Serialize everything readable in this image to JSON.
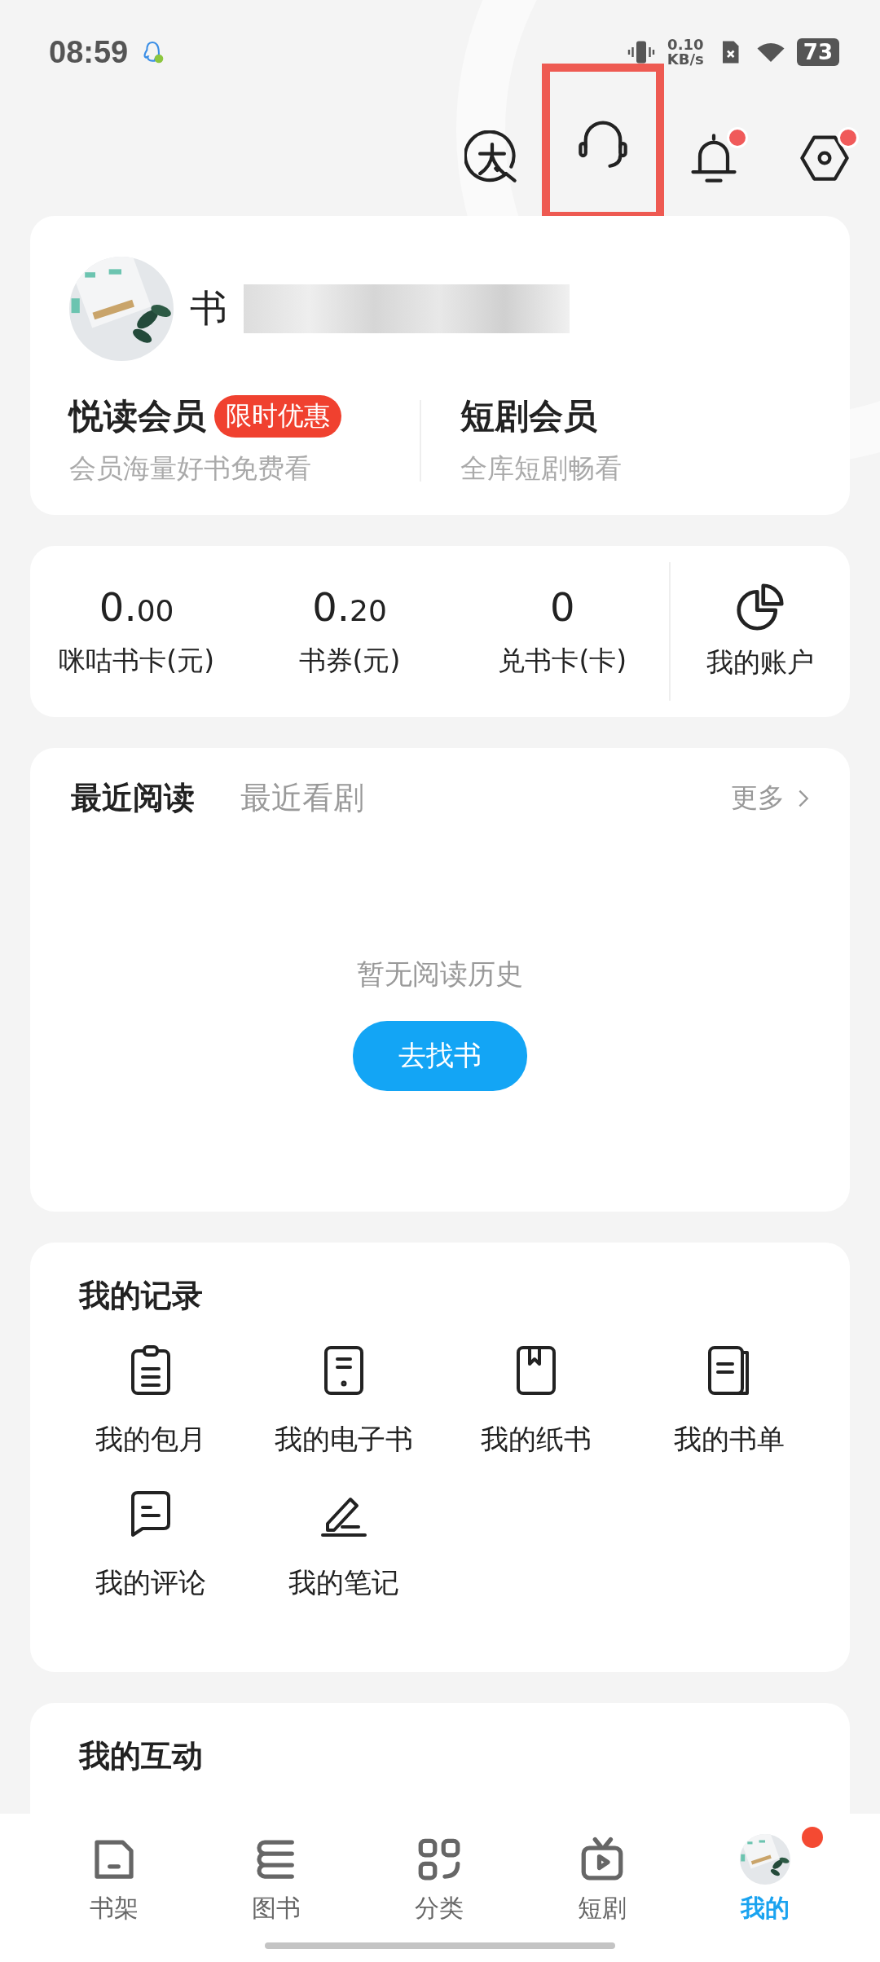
{
  "status_bar": {
    "time": "08:59",
    "speed_value": "0.10",
    "speed_unit": "KB/s",
    "battery": "73"
  },
  "top_actions": [
    {
      "kind": "font",
      "badge": false,
      "highlighted": false
    },
    {
      "kind": "headset",
      "badge": false,
      "highlighted": true
    },
    {
      "kind": "bell",
      "badge": true,
      "highlighted": false
    },
    {
      "kind": "settings",
      "badge": true,
      "highlighted": false
    }
  ],
  "profile": {
    "name": "书",
    "memberships": [
      {
        "title": "悦读会员",
        "tag": "限时优惠",
        "subtitle": "会员海量好书免费看"
      },
      {
        "title": "短剧会员",
        "subtitle": "全库短剧畅看"
      }
    ]
  },
  "wallet": [
    {
      "main": "0.",
      "fraction": "00",
      "label": "咪咕书卡(元)"
    },
    {
      "main": "0.",
      "fraction": "20",
      "label": "书券(元)"
    },
    {
      "main": "0",
      "label": "兑书卡(卡)"
    }
  ],
  "account_label": "我的账户",
  "recent": {
    "tabs": [
      {
        "label": "最近阅读",
        "selected": true
      },
      {
        "label": "最近看剧",
        "selected": false
      }
    ],
    "more": "更多",
    "empty_text": "暂无阅读历史",
    "button": "去找书"
  },
  "records": {
    "title": "我的记录",
    "items": [
      {
        "kind": "clipboard",
        "label": "我的包月"
      },
      {
        "kind": "tablet",
        "label": "我的电子书"
      },
      {
        "kind": "book",
        "label": "我的纸书"
      },
      {
        "kind": "booklist",
        "label": "我的书单"
      },
      {
        "kind": "comment",
        "label": "我的评论"
      },
      {
        "kind": "pen",
        "label": "我的笔记"
      }
    ]
  },
  "interaction": {
    "title": "我的互动"
  },
  "nav": [
    {
      "kind": "shelf",
      "label": "书架",
      "selected": false
    },
    {
      "kind": "books",
      "label": "图书",
      "selected": false
    },
    {
      "kind": "grid",
      "label": "分类",
      "selected": false
    },
    {
      "kind": "tv",
      "label": "短剧",
      "selected": false
    },
    {
      "kind": "avatar",
      "label": "我的",
      "selected": true,
      "badge": true
    }
  ]
}
